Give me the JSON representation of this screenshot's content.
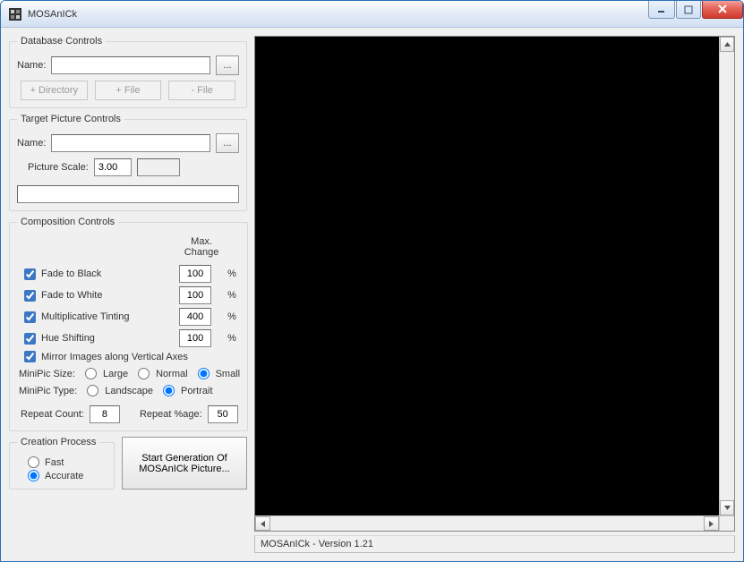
{
  "window": {
    "title": "MOSAnICk"
  },
  "database": {
    "legend": "Database Controls",
    "name_label": "Name:",
    "name_value": "",
    "browse_label": "...",
    "btn_dir": "+ Directory",
    "btn_add_file": "+ File",
    "btn_remove_file": "- File"
  },
  "target": {
    "legend": "Target Picture Controls",
    "name_label": "Name:",
    "name_value": "",
    "browse_label": "...",
    "scale_label": "Picture Scale:",
    "scale_value": "3.00"
  },
  "composition": {
    "legend": "Composition Controls",
    "max_label": "Max. Change",
    "rows": [
      {
        "label": "Fade to Black",
        "value": "100",
        "checked": true
      },
      {
        "label": "Fade to White",
        "value": "100",
        "checked": true
      },
      {
        "label": "Multiplicative Tinting",
        "value": "400",
        "checked": true
      },
      {
        "label": "Hue Shifting",
        "value": "100",
        "checked": true
      }
    ],
    "mirror_label": "Mirror Images along Vertical Axes",
    "mirror_checked": true,
    "size_label": "MiniPic Size:",
    "size_opts": {
      "large": "Large",
      "normal": "Normal",
      "small": "Small"
    },
    "size_selected": "small",
    "type_label": "MiniPic Type:",
    "type_opts": {
      "landscape": "Landscape",
      "portrait": "Portrait"
    },
    "type_selected": "portrait",
    "repeat_count_label": "Repeat Count:",
    "repeat_count_value": "8",
    "repeat_pct_label": "Repeat %age:",
    "repeat_pct_value": "50",
    "pct_sign": "%"
  },
  "creation": {
    "legend": "Creation Process",
    "fast": "Fast",
    "accurate": "Accurate",
    "selected": "accurate"
  },
  "generate_label": "Start Generation Of MOSAnICk Picture...",
  "status_text": "MOSAnICk - Version 1.21"
}
